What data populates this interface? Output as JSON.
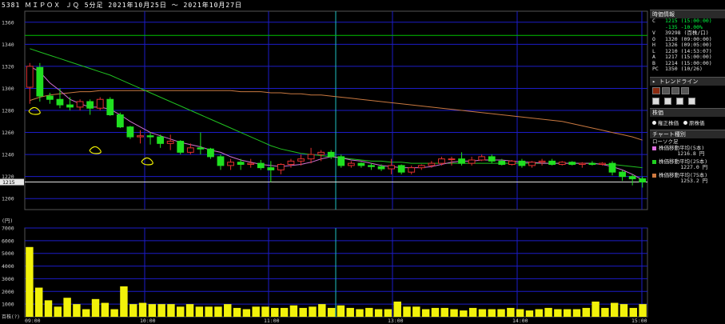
{
  "title": "5381 ＭＩＰＯＸ ＪＱ 5分足 2021年10月25日 ～ 2021年10月27日",
  "price_axis": {
    "ticks": [
      "1360",
      "1340",
      "1320",
      "1300",
      "1280",
      "1260",
      "1240",
      "1220",
      "1200"
    ],
    "current_label": "1215",
    "unit": "(円)"
  },
  "volume_axis": {
    "ticks": [
      "7000",
      "6000",
      "5000",
      "4000",
      "3000",
      "2000",
      "1000"
    ],
    "unit": "百株(?)"
  },
  "time_labels": [
    "09:00",
    "10:00",
    "11:00",
    "13:00",
    "14:00",
    "15:00"
  ],
  "panel": {
    "quote_header": "時価情報",
    "quote": [
      {
        "k": "C",
        "v": "1215 (15:00:00)",
        "green": true
      },
      {
        "k": "",
        "v": "-135 -10.00%",
        "green": true
      },
      {
        "k": "V",
        "v": "39298 (百株/口)",
        "green": false
      },
      {
        "k": "O",
        "v": "1320 (09:00:00)",
        "green": false
      },
      {
        "k": "H",
        "v": "1326 (09:05:00)",
        "green": false
      },
      {
        "k": "L",
        "v": "1210 (14:53:07)",
        "green": false
      },
      {
        "k": "A",
        "v": "1217 (15:00:00)",
        "green": false
      },
      {
        "k": "B",
        "v": "1214 (15:00:00)",
        "green": false
      },
      {
        "k": "PC",
        "v": "1350 (10/26)",
        "green": false
      }
    ],
    "trend_header": "トレンドライン",
    "kabuka_header": "株価",
    "radio_a": "権正株価",
    "radio_b": "原株価",
    "chart_kind_header": "チャート種別",
    "chart_kind": "ローソク足",
    "legend": [
      {
        "name": "株価移動平均(5本)",
        "value": "1216.8 円",
        "color": "#e070e0"
      },
      {
        "name": "株価移動平均(25本)",
        "value": "1227.0 円",
        "color": "#20d020"
      },
      {
        "name": "株価移動平均(75本)",
        "value": "1253.2 円",
        "color": "#d07a40"
      }
    ]
  },
  "colors": {
    "up_candle": "#000000",
    "down_candle": "#20e020",
    "wick_up": "#e03030",
    "grid": "#1c1cc8",
    "volume": "#f2f20a",
    "ma5": "#d070d0",
    "ma25": "#20c020",
    "ma75": "#c87840",
    "hline": "#00c000"
  },
  "chart_data": {
    "type": "candlestick",
    "ylim": [
      1190,
      1370
    ],
    "volume_ylim": [
      0,
      7000
    ],
    "candles": [
      {
        "o": 1301,
        "h": 1323,
        "l": 1286,
        "c": 1320
      },
      {
        "o": 1319,
        "h": 1323,
        "l": 1288,
        "c": 1293
      },
      {
        "o": 1293,
        "h": 1296,
        "l": 1286,
        "c": 1290
      },
      {
        "o": 1290,
        "h": 1300,
        "l": 1282,
        "c": 1285
      },
      {
        "o": 1285,
        "h": 1292,
        "l": 1280,
        "c": 1283
      },
      {
        "o": 1283,
        "h": 1290,
        "l": 1280,
        "c": 1288
      },
      {
        "o": 1288,
        "h": 1290,
        "l": 1276,
        "c": 1282
      },
      {
        "o": 1282,
        "h": 1292,
        "l": 1280,
        "c": 1290
      },
      {
        "o": 1290,
        "h": 1292,
        "l": 1275,
        "c": 1276
      },
      {
        "o": 1276,
        "h": 1278,
        "l": 1264,
        "c": 1265
      },
      {
        "o": 1265,
        "h": 1266,
        "l": 1254,
        "c": 1256
      },
      {
        "o": 1256,
        "h": 1262,
        "l": 1250,
        "c": 1257
      },
      {
        "o": 1257,
        "h": 1260,
        "l": 1249,
        "c": 1256
      },
      {
        "o": 1256,
        "h": 1258,
        "l": 1246,
        "c": 1250
      },
      {
        "o": 1250,
        "h": 1258,
        "l": 1244,
        "c": 1252
      },
      {
        "o": 1252,
        "h": 1253,
        "l": 1240,
        "c": 1242
      },
      {
        "o": 1242,
        "h": 1250,
        "l": 1240,
        "c": 1246
      },
      {
        "o": 1246,
        "h": 1260,
        "l": 1240,
        "c": 1245
      },
      {
        "o": 1245,
        "h": 1246,
        "l": 1236,
        "c": 1238
      },
      {
        "o": 1238,
        "h": 1240,
        "l": 1226,
        "c": 1230
      },
      {
        "o": 1230,
        "h": 1236,
        "l": 1226,
        "c": 1233
      },
      {
        "o": 1233,
        "h": 1236,
        "l": 1226,
        "c": 1231
      },
      {
        "o": 1231,
        "h": 1236,
        "l": 1228,
        "c": 1232
      },
      {
        "o": 1232,
        "h": 1235,
        "l": 1226,
        "c": 1228
      },
      {
        "o": 1228,
        "h": 1234,
        "l": 1215,
        "c": 1226
      },
      {
        "o": 1226,
        "h": 1232,
        "l": 1222,
        "c": 1231
      },
      {
        "o": 1231,
        "h": 1236,
        "l": 1228,
        "c": 1234
      },
      {
        "o": 1234,
        "h": 1240,
        "l": 1230,
        "c": 1236
      },
      {
        "o": 1236,
        "h": 1246,
        "l": 1232,
        "c": 1240
      },
      {
        "o": 1240,
        "h": 1244,
        "l": 1234,
        "c": 1242
      },
      {
        "o": 1242,
        "h": 1244,
        "l": 1236,
        "c": 1238
      },
      {
        "o": 1238,
        "h": 1240,
        "l": 1228,
        "c": 1230
      },
      {
        "o": 1230,
        "h": 1234,
        "l": 1228,
        "c": 1232
      },
      {
        "o": 1232,
        "h": 1233,
        "l": 1228,
        "c": 1230
      },
      {
        "o": 1230,
        "h": 1232,
        "l": 1226,
        "c": 1229
      },
      {
        "o": 1229,
        "h": 1231,
        "l": 1225,
        "c": 1227
      },
      {
        "o": 1227,
        "h": 1236,
        "l": 1222,
        "c": 1230
      },
      {
        "o": 1230,
        "h": 1231,
        "l": 1222,
        "c": 1224
      },
      {
        "o": 1224,
        "h": 1230,
        "l": 1222,
        "c": 1228
      },
      {
        "o": 1228,
        "h": 1231,
        "l": 1226,
        "c": 1230
      },
      {
        "o": 1230,
        "h": 1234,
        "l": 1228,
        "c": 1232
      },
      {
        "o": 1232,
        "h": 1238,
        "l": 1230,
        "c": 1236
      },
      {
        "o": 1236,
        "h": 1238,
        "l": 1230,
        "c": 1236
      },
      {
        "o": 1236,
        "h": 1242,
        "l": 1230,
        "c": 1232
      },
      {
        "o": 1232,
        "h": 1238,
        "l": 1230,
        "c": 1235
      },
      {
        "o": 1235,
        "h": 1240,
        "l": 1234,
        "c": 1238
      },
      {
        "o": 1238,
        "h": 1240,
        "l": 1232,
        "c": 1234
      },
      {
        "o": 1234,
        "h": 1236,
        "l": 1230,
        "c": 1231
      },
      {
        "o": 1231,
        "h": 1235,
        "l": 1230,
        "c": 1234
      },
      {
        "o": 1234,
        "h": 1236,
        "l": 1228,
        "c": 1230
      },
      {
        "o": 1230,
        "h": 1234,
        "l": 1228,
        "c": 1233
      },
      {
        "o": 1233,
        "h": 1236,
        "l": 1230,
        "c": 1234
      },
      {
        "o": 1234,
        "h": 1236,
        "l": 1230,
        "c": 1231
      },
      {
        "o": 1231,
        "h": 1234,
        "l": 1230,
        "c": 1233
      },
      {
        "o": 1233,
        "h": 1234,
        "l": 1230,
        "c": 1231
      },
      {
        "o": 1231,
        "h": 1233,
        "l": 1228,
        "c": 1232
      },
      {
        "o": 1232,
        "h": 1234,
        "l": 1230,
        "c": 1231
      },
      {
        "o": 1231,
        "h": 1233,
        "l": 1230,
        "c": 1232
      },
      {
        "o": 1232,
        "h": 1234,
        "l": 1221,
        "c": 1224
      },
      {
        "o": 1224,
        "h": 1226,
        "l": 1216,
        "c": 1220
      },
      {
        "o": 1220,
        "h": 1222,
        "l": 1212,
        "c": 1218
      },
      {
        "o": 1218,
        "h": 1220,
        "l": 1210,
        "c": 1215
      }
    ],
    "volume": [
      5500,
      2300,
      1300,
      800,
      1500,
      1000,
      600,
      1400,
      1100,
      600,
      2400,
      1000,
      1100,
      1000,
      1000,
      1000,
      800,
      1000,
      800,
      800,
      800,
      1000,
      700,
      600,
      800,
      800,
      700,
      700,
      900,
      700,
      800,
      1000,
      700,
      900,
      700,
      600,
      700,
      600,
      600,
      1200,
      800,
      800,
      600,
      700,
      700,
      600,
      500,
      700,
      600,
      600,
      600,
      700,
      600,
      500,
      600,
      700,
      600,
      600,
      600,
      700,
      1200,
      700,
      1100,
      1000,
      700,
      1000
    ],
    "ma5": [
      1320,
      1315,
      1305,
      1298,
      1290,
      1286,
      1283,
      1283,
      1281,
      1276,
      1270,
      1265,
      1260,
      1257,
      1254,
      1251,
      1249,
      1247,
      1244,
      1242,
      1238,
      1235,
      1233,
      1231,
      1230,
      1229,
      1230,
      1231,
      1233,
      1236,
      1238,
      1237,
      1235,
      1234,
      1232,
      1230,
      1229,
      1228,
      1228,
      1228,
      1229,
      1231,
      1233,
      1234,
      1234,
      1235,
      1235,
      1235,
      1234,
      1233,
      1233,
      1232,
      1232,
      1232,
      1232,
      1232,
      1232,
      1231,
      1229,
      1226,
      1222,
      1217
    ],
    "ma25": [
      1336,
      1333,
      1330,
      1327,
      1324,
      1321,
      1318,
      1315,
      1312,
      1308,
      1304,
      1300,
      1296,
      1292,
      1288,
      1284,
      1280,
      1276,
      1272,
      1268,
      1264,
      1260,
      1256,
      1252,
      1248,
      1245,
      1243,
      1241,
      1240,
      1239,
      1238,
      1237,
      1236,
      1235,
      1234,
      1234,
      1233,
      1233,
      1232,
      1232,
      1232,
      1232,
      1232,
      1232,
      1232,
      1232,
      1232,
      1232,
      1232,
      1232,
      1232,
      1232,
      1232,
      1232,
      1232,
      1232,
      1232,
      1231,
      1231,
      1230,
      1229,
      1228
    ],
    "ma75": [
      1289,
      1292,
      1294,
      1295,
      1296,
      1297,
      1297,
      1298,
      1298,
      1298,
      1298,
      1298,
      1298,
      1298,
      1298,
      1298,
      1298,
      1298,
      1298,
      1298,
      1298,
      1297,
      1297,
      1297,
      1296,
      1296,
      1295,
      1295,
      1294,
      1294,
      1293,
      1292,
      1291,
      1290,
      1289,
      1288,
      1287,
      1286,
      1285,
      1284,
      1283,
      1282,
      1281,
      1280,
      1279,
      1278,
      1277,
      1276,
      1275,
      1274,
      1273,
      1272,
      1271,
      1270,
      1268,
      1266,
      1264,
      1262,
      1260,
      1258,
      1256,
      1253
    ],
    "hline": 1348
  }
}
